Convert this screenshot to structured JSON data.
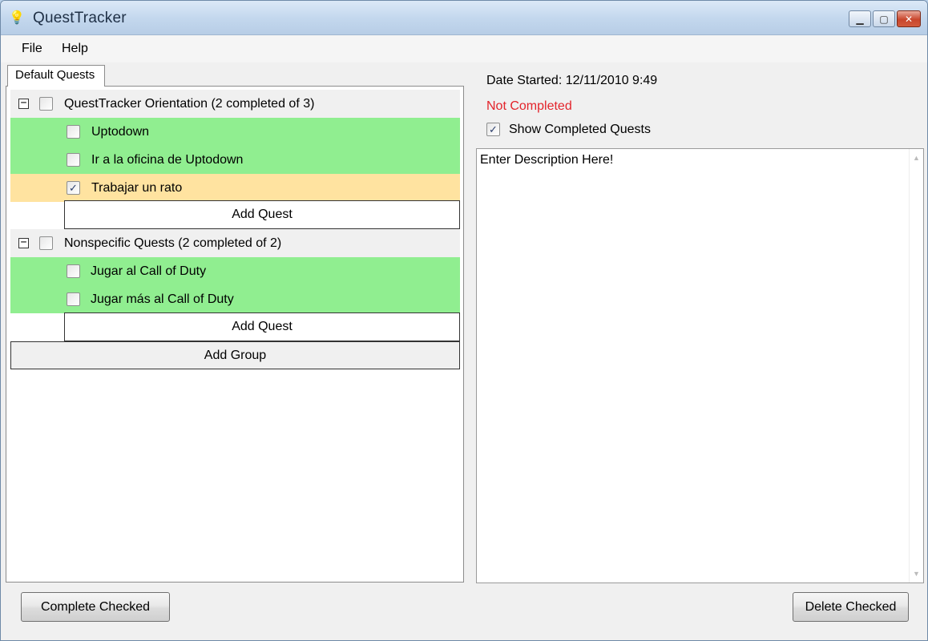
{
  "window": {
    "title": "QuestTracker"
  },
  "menu": {
    "file": "File",
    "help": "Help"
  },
  "tabs": [
    {
      "label": "Default Quests",
      "active": true
    }
  ],
  "groups": [
    {
      "title": "QuestTracker Orientation (2 completed of 3)",
      "expander": "−",
      "checked": false,
      "quests": [
        {
          "label": "Uptodown",
          "checked": false,
          "state": "completed"
        },
        {
          "label": "Ir a la oficina de Uptodown",
          "checked": false,
          "state": "completed"
        },
        {
          "label": "Trabajar un rato",
          "checked": true,
          "state": "selected"
        }
      ],
      "add_quest_label": "Add Quest"
    },
    {
      "title": "Nonspecific Quests (2 completed of 2)",
      "expander": "−",
      "checked": false,
      "quests": [
        {
          "label": "Jugar al Call of Duty",
          "checked": false,
          "state": "completed"
        },
        {
          "label": "Jugar más al Call of Duty",
          "checked": false,
          "state": "completed"
        }
      ],
      "add_quest_label": "Add Quest"
    }
  ],
  "add_group_label": "Add Group",
  "details": {
    "date_started": "Date Started: 12/11/2010 9:49",
    "status": "Not Completed",
    "show_completed_label": "Show Completed Quests",
    "show_completed_checked": true,
    "description": "Enter Description Here!"
  },
  "buttons": {
    "complete_checked": "Complete Checked",
    "delete_checked": "Delete Checked"
  },
  "colors": {
    "completed_row": "#90ee90",
    "selected_row": "#ffe3a0",
    "status_text": "#e3242b"
  },
  "icons": {
    "app": "lightbulb-icon",
    "check": "✓"
  }
}
